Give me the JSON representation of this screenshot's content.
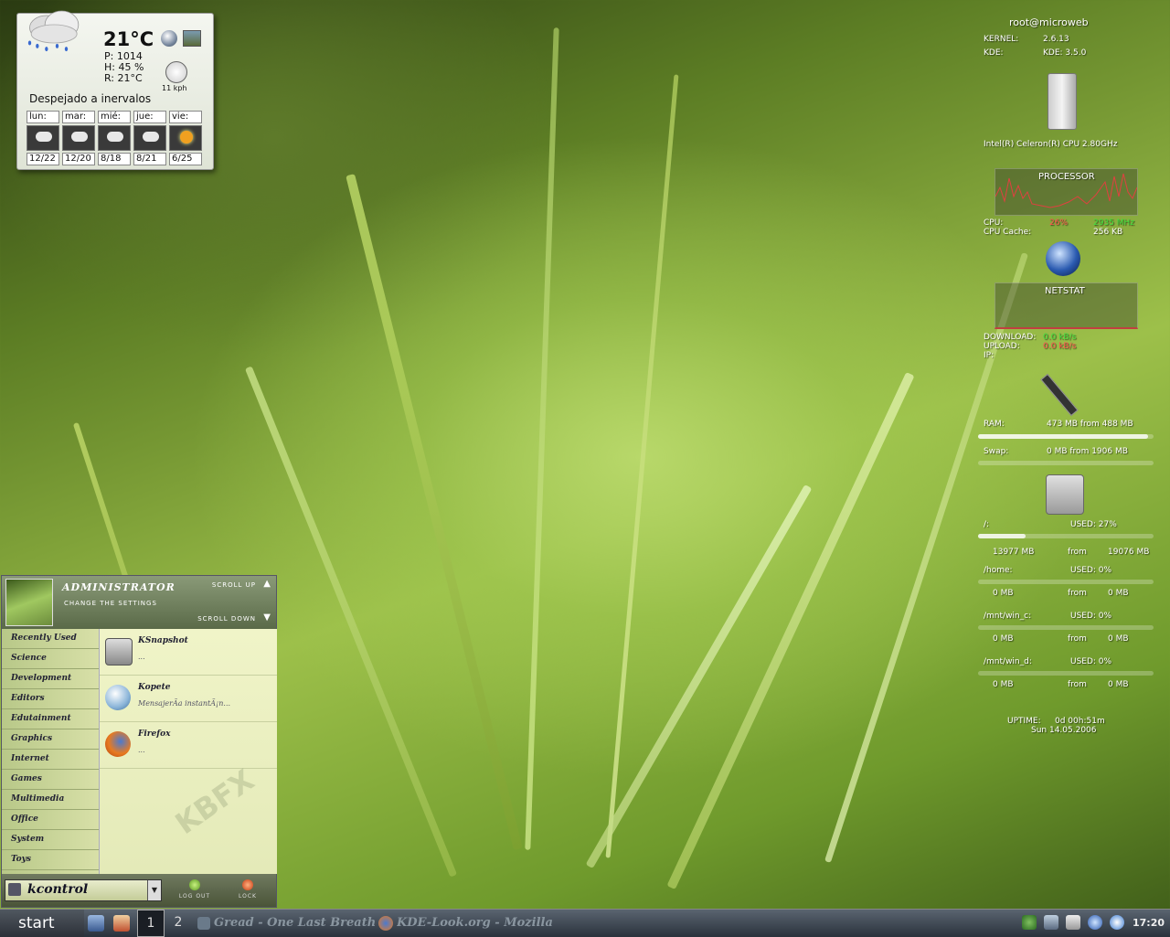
{
  "weather": {
    "temp": "21°C",
    "pressure": "P: 1014",
    "humidity": "H: 45 %",
    "real_feel": "R: 21°C",
    "wind": "11 kph",
    "description": "Despejado a inervalos",
    "days": [
      {
        "name": "lun:",
        "temp": "12/22",
        "icon": "cloud-icon"
      },
      {
        "name": "mar:",
        "temp": "12/20",
        "icon": "cloud-icon"
      },
      {
        "name": "mié:",
        "temp": "8/18",
        "icon": "cloud-icon"
      },
      {
        "name": "jue:",
        "temp": "8/21",
        "icon": "cloud-icon"
      },
      {
        "name": "vie:",
        "temp": "6/25",
        "icon": "sun-icon"
      }
    ]
  },
  "sysmon": {
    "user": "root@microweb",
    "kernel_label": "KERNEL:",
    "kernel": "2.6.13",
    "kde_label": "KDE:",
    "kde": "KDE: 3.5.0",
    "cpu_model": "Intel(R) Celeron(R) CPU 2.80GHz",
    "processor_title": "PROCESSOR",
    "cpu_label": "CPU:",
    "cpu_usage": "26%",
    "cpu_freq": "2935 MHz",
    "cache_label": "CPU Cache:",
    "cache": "256 KB",
    "netstat_title": "NETSTAT",
    "download_label": "DOWNLOAD:",
    "download": "0.0 kB/s",
    "upload_label": "UPLOAD:",
    "upload": "0.0 kB/s",
    "ip_label": "IP:",
    "ram_label": "RAM:",
    "ram": "473 MB from 488 MB",
    "ram_fraction": 0.97,
    "swap_label": "Swap:",
    "swap": "0 MB from 1906 MB",
    "swap_fraction": 0.0,
    "disks": [
      {
        "mount": "/:",
        "used": "USED: 27%",
        "fraction": 0.27,
        "used_mb": "13977 MB",
        "from": "from",
        "total_mb": "19076 MB"
      },
      {
        "mount": "/home:",
        "used": "USED: 0%",
        "fraction": 0.0,
        "used_mb": "0 MB",
        "from": "from",
        "total_mb": "0 MB"
      },
      {
        "mount": "/mnt/win_c:",
        "used": "USED: 0%",
        "fraction": 0.0,
        "used_mb": "0 MB",
        "from": "from",
        "total_mb": "0 MB"
      },
      {
        "mount": "/mnt/win_d:",
        "used": "USED: 0%",
        "fraction": 0.0,
        "used_mb": "0 MB",
        "from": "from",
        "total_mb": "0 MB"
      }
    ],
    "uptime_label": "UPTIME:",
    "uptime": "0d  00h:51m",
    "date": "Sun 14.05.2006"
  },
  "menu": {
    "user": "ADMINISTRATOR",
    "subtitle": "CHANGE THE SETTINGS",
    "scroll_up": "SCROLL UP",
    "scroll_down": "SCROLL DOWN",
    "categories": [
      "Recently Used",
      "Science",
      "Development",
      "Editors",
      "Edutainment",
      "Graphics",
      "Internet",
      "Games",
      "Multimedia",
      "Office",
      "System",
      "Toys"
    ],
    "apps": [
      {
        "name": "KSnapshot",
        "desc": "..."
      },
      {
        "name": "Kopete",
        "desc": "MensajerÃ­a instantÃ¡n..."
      },
      {
        "name": "Firefox",
        "desc": "..."
      }
    ],
    "watermark": "KBFX",
    "search_value": "kcontrol",
    "logout": "LOG OUT",
    "lock": "LOCK"
  },
  "taskbar": {
    "start": "start",
    "desktops": [
      "1",
      "2"
    ],
    "tasks": [
      "Gread - One Last Breath",
      "KDE-Look.org - Mozilla"
    ],
    "clock": "17:20"
  }
}
